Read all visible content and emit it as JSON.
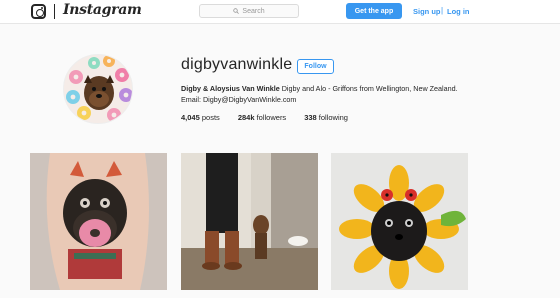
{
  "header": {
    "brand": "Instagram",
    "search_placeholder": "Search",
    "get_app_label": "Get the app",
    "signup_label": "Sign up",
    "separator": "|",
    "login_label": "Log in",
    "icons": [
      "instagram-glyph-icon",
      "search-icon"
    ],
    "accent_color": "#3897f0"
  },
  "profile": {
    "username": "digbyvanwinkle",
    "follow_label": "Follow",
    "full_name": "Digby & Aloysius Van Winkle",
    "bio_text": "Digby and Alo - Griffons from Wellington, New Zealand. Email: Digby@DigbyVanWinkle.com",
    "stats": {
      "posts_count": "4,045",
      "posts_label": "posts",
      "followers_count": "284k",
      "followers_label": "followers",
      "following_count": "338",
      "following_label": "following"
    }
  },
  "posts": [
    {
      "subject": "dog-tattoo-photo"
    },
    {
      "subject": "dog-with-boots-photo"
    },
    {
      "subject": "dog-in-sunflower-costume-photo"
    }
  ]
}
